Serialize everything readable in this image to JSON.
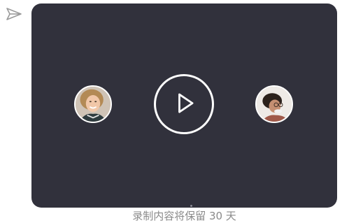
{
  "icons": {
    "send": "send-icon",
    "play": "play-icon"
  },
  "video": {
    "background_color": "#31313c",
    "participants": [
      {
        "name": "participant-left"
      },
      {
        "name": "participant-right"
      }
    ]
  },
  "footer": {
    "retention_note": "录制内容将保留 30 天"
  }
}
